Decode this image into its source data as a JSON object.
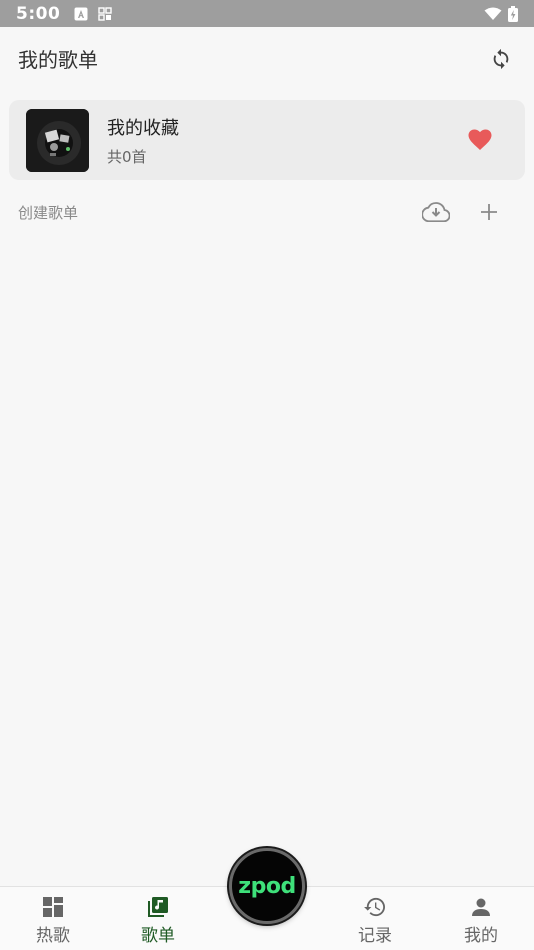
{
  "status_bar": {
    "time": "5:00",
    "icons": [
      "notification-a-icon",
      "notification-grid-icon",
      "wifi-icon",
      "battery-icon"
    ]
  },
  "header": {
    "title": "我的歌单",
    "sync_icon": "sync-icon"
  },
  "favorites": {
    "title": "我的收藏",
    "count": "共0首",
    "heart_icon": "heart-icon",
    "heart_color": "#e85a5a"
  },
  "playlists_section": {
    "label": "创建歌单",
    "cloud_icon": "cloud-download-icon",
    "add_icon": "plus-icon"
  },
  "player": {
    "label": "zpod",
    "label_color": "#3ee07a"
  },
  "bottom_nav": {
    "items": [
      {
        "label": "热歌",
        "icon": "grid-icon",
        "active": false
      },
      {
        "label": "歌单",
        "icon": "music-library-icon",
        "active": true
      },
      {
        "label": "记录",
        "icon": "history-icon",
        "active": false
      },
      {
        "label": "我的",
        "icon": "person-icon",
        "active": false
      }
    ],
    "active_color": "#1f5a24"
  }
}
